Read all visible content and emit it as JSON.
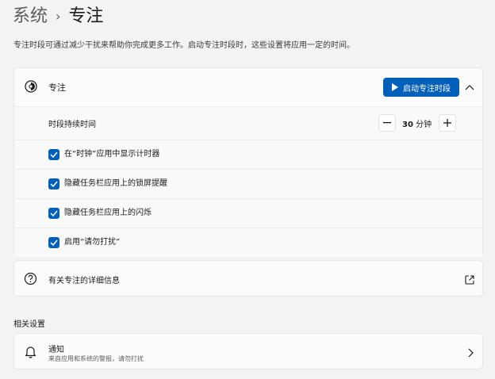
{
  "breadcrumb": {
    "parent": "系统",
    "current": "专注"
  },
  "subtitle": "专注时段可通过减少干扰来帮助你完成更多工作。启动专注时段时，这些设置将应用一定的时间。",
  "focus": {
    "title": "专注",
    "start_button": "启动专注时段",
    "duration_label": "时段持续时间",
    "duration_value": "30",
    "duration_unit": "分钟",
    "checkboxes": [
      {
        "label": "在“时钟”应用中显示计时器",
        "checked": true
      },
      {
        "label": "隐藏任务栏应用上的锁屏提醒",
        "checked": true
      },
      {
        "label": "隐藏任务栏应用上的闪烁",
        "checked": true
      },
      {
        "label": "启用“请勿打扰”",
        "checked": true
      }
    ]
  },
  "more_info": {
    "label": "有关专注的详细信息"
  },
  "related": {
    "title": "相关设置",
    "notifications": {
      "title": "通知",
      "desc": "来自应用和系统的警报，请勿打扰"
    }
  },
  "colors": {
    "accent": "#005fb8",
    "background": "#f3f3f3",
    "card": "#fbfbfb"
  }
}
